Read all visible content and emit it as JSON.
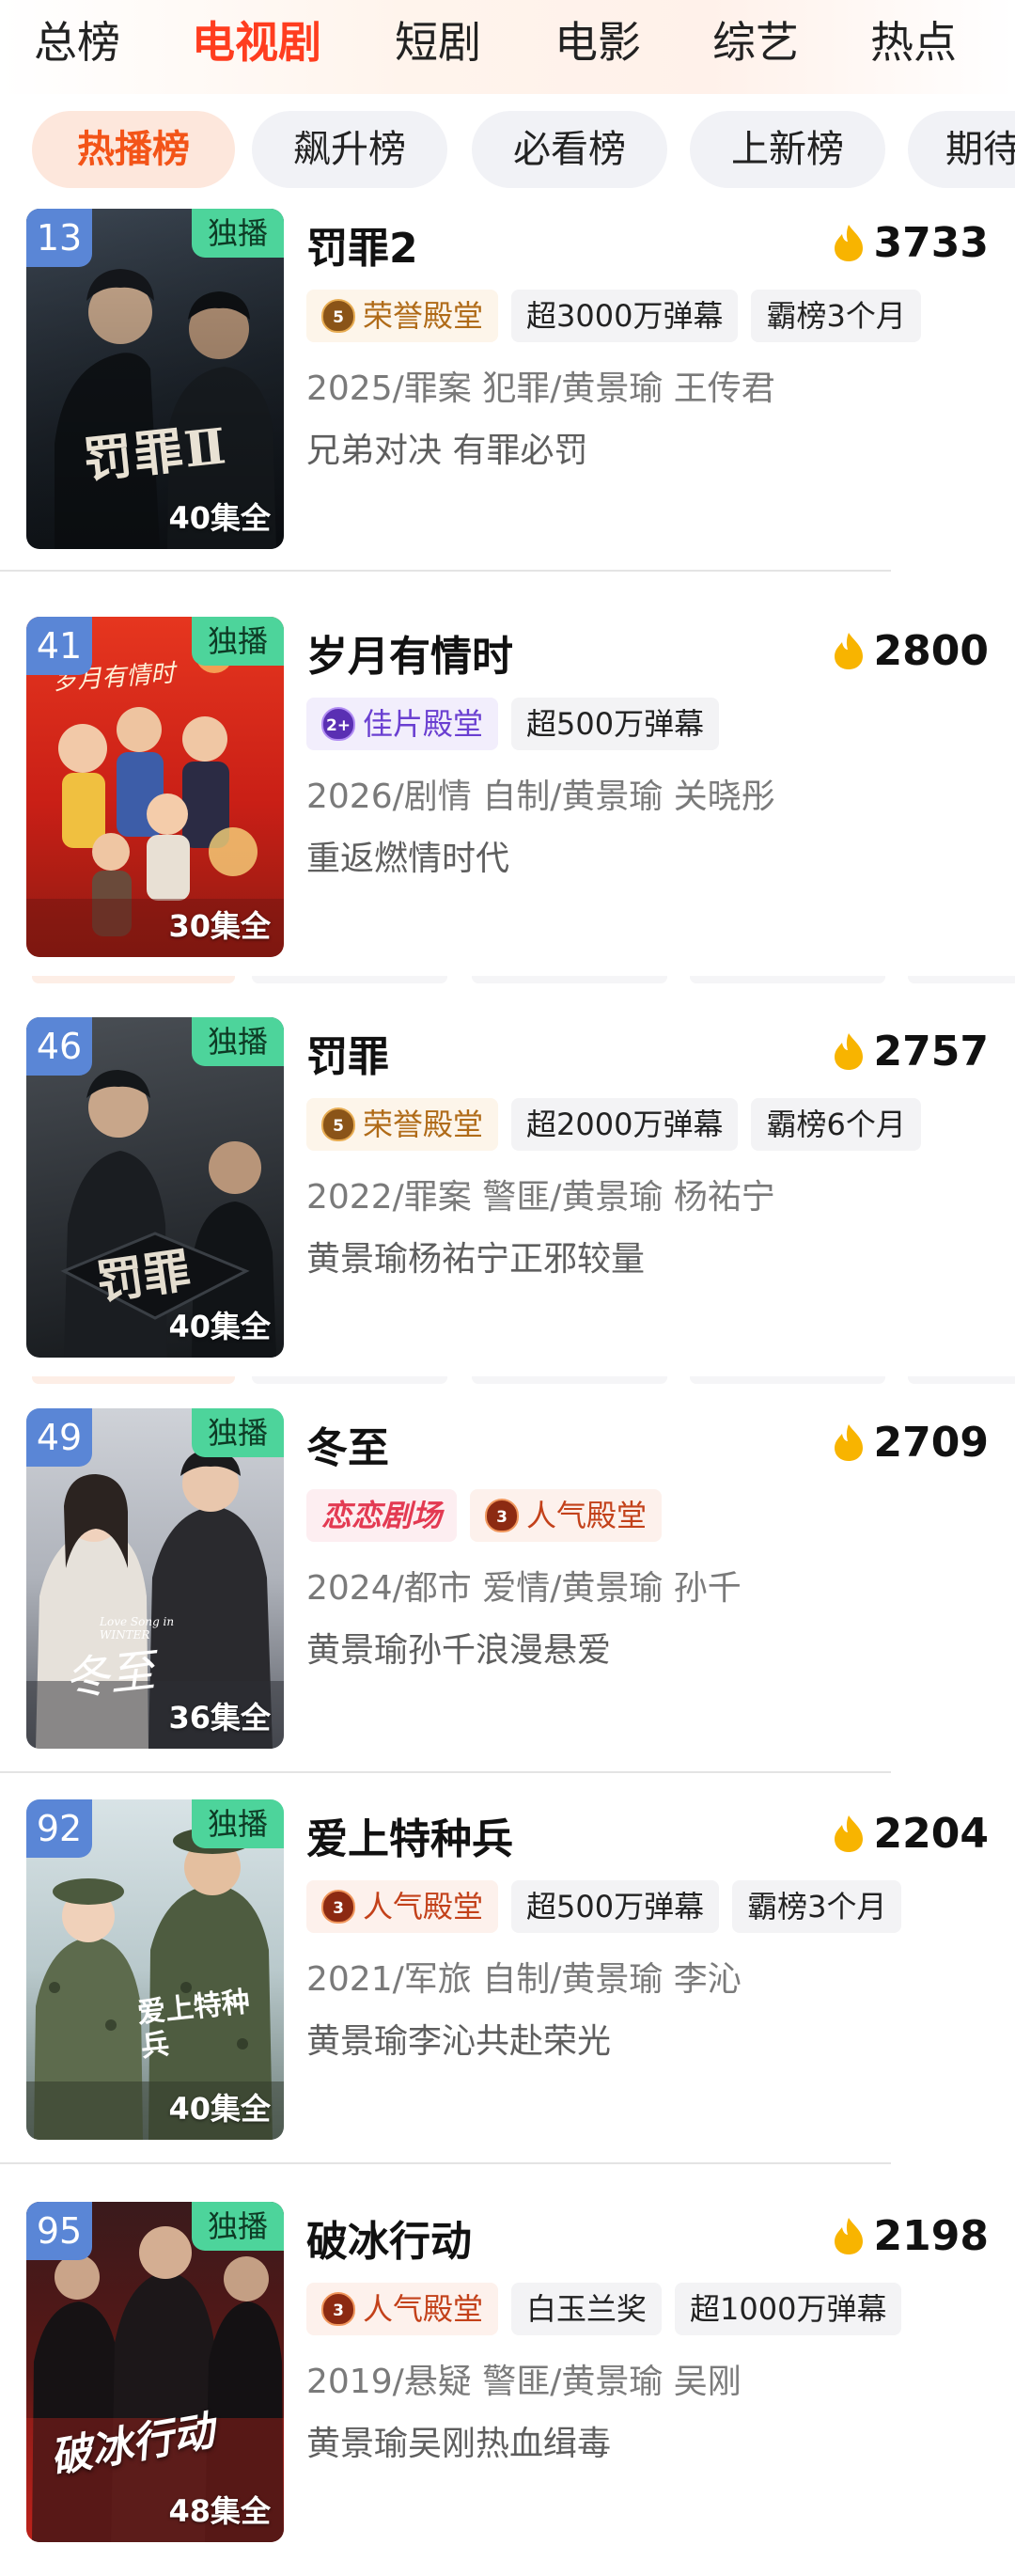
{
  "top_tabs": [
    "总榜",
    "电视剧",
    "短剧",
    "电影",
    "综艺",
    "热点"
  ],
  "chips": [
    "热播榜",
    "飙升榜",
    "必看榜",
    "上新榜",
    "期待"
  ],
  "colors": {
    "accent": "#ff3d1f",
    "heat": "#f8b400",
    "exclusive": "#4dd49b",
    "rank": "#5a86d6"
  },
  "items": [
    {
      "rank": "13",
      "exclusive": "独播",
      "title": "罚罪2",
      "heat": "3733",
      "tags": [
        {
          "icon": "5",
          "label": "荣誉殿堂"
        },
        {
          "label": "超3000万弹幕"
        },
        {
          "label": "霸榜3个月"
        }
      ],
      "meta": "2025/罪案 犯罪/黄景瑜 王传君",
      "desc": "兄弟对决 有罪必罚",
      "episodes": "40集全",
      "poster_text": "罚罪Ⅱ"
    },
    {
      "rank": "41",
      "exclusive": "独播",
      "title": "岁月有情时",
      "heat": "2800",
      "tags": [
        {
          "icon": "2+",
          "label": "佳片殿堂"
        },
        {
          "label": "超500万弹幕"
        }
      ],
      "meta": "2026/剧情 自制/黄景瑜 关晓彤",
      "desc": "重返燃情时代",
      "episodes": "30集全",
      "poster_text": "岁月有情时"
    },
    {
      "rank": "46",
      "exclusive": "独播",
      "title": "罚罪",
      "heat": "2757",
      "tags": [
        {
          "icon": "5",
          "label": "荣誉殿堂"
        },
        {
          "label": "超2000万弹幕"
        },
        {
          "label": "霸榜6个月"
        }
      ],
      "meta": "2022/罪案 警匪/黄景瑜 杨祐宁",
      "desc": "黄景瑜杨祐宁正邪较量",
      "episodes": "40集全",
      "poster_text": "罚罪"
    },
    {
      "rank": "49",
      "exclusive": "独播",
      "title": "冬至",
      "heat": "2709",
      "tags": [
        {
          "label": "恋恋剧场"
        },
        {
          "icon": "3",
          "label": "人气殿堂"
        }
      ],
      "meta": "2024/都市 爱情/黄景瑜 孙千",
      "desc": "黄景瑜孙千浪漫悬爱",
      "episodes": "36集全",
      "poster_text": "冬至",
      "poster_subtext": "Love Song in WINTER"
    },
    {
      "rank": "92",
      "exclusive": "独播",
      "title": "爱上特种兵",
      "heat": "2204",
      "tags": [
        {
          "icon": "3",
          "label": "人气殿堂"
        },
        {
          "label": "超500万弹幕"
        },
        {
          "label": "霸榜3个月"
        }
      ],
      "meta": "2021/军旅 自制/黄景瑜 李沁",
      "desc": "黄景瑜李沁共赴荣光",
      "episodes": "40集全",
      "poster_text": "爱上特种兵"
    },
    {
      "rank": "95",
      "exclusive": "独播",
      "title": "破冰行动",
      "heat": "2198",
      "tags": [
        {
          "icon": "3",
          "label": "人气殿堂"
        },
        {
          "label": "白玉兰奖"
        },
        {
          "label": "超1000万弹幕"
        }
      ],
      "meta": "2019/悬疑 警匪/黄景瑜 吴刚",
      "desc": "黄景瑜吴刚热血缉毒",
      "episodes": "48集全",
      "poster_text": "破冰行动"
    }
  ]
}
